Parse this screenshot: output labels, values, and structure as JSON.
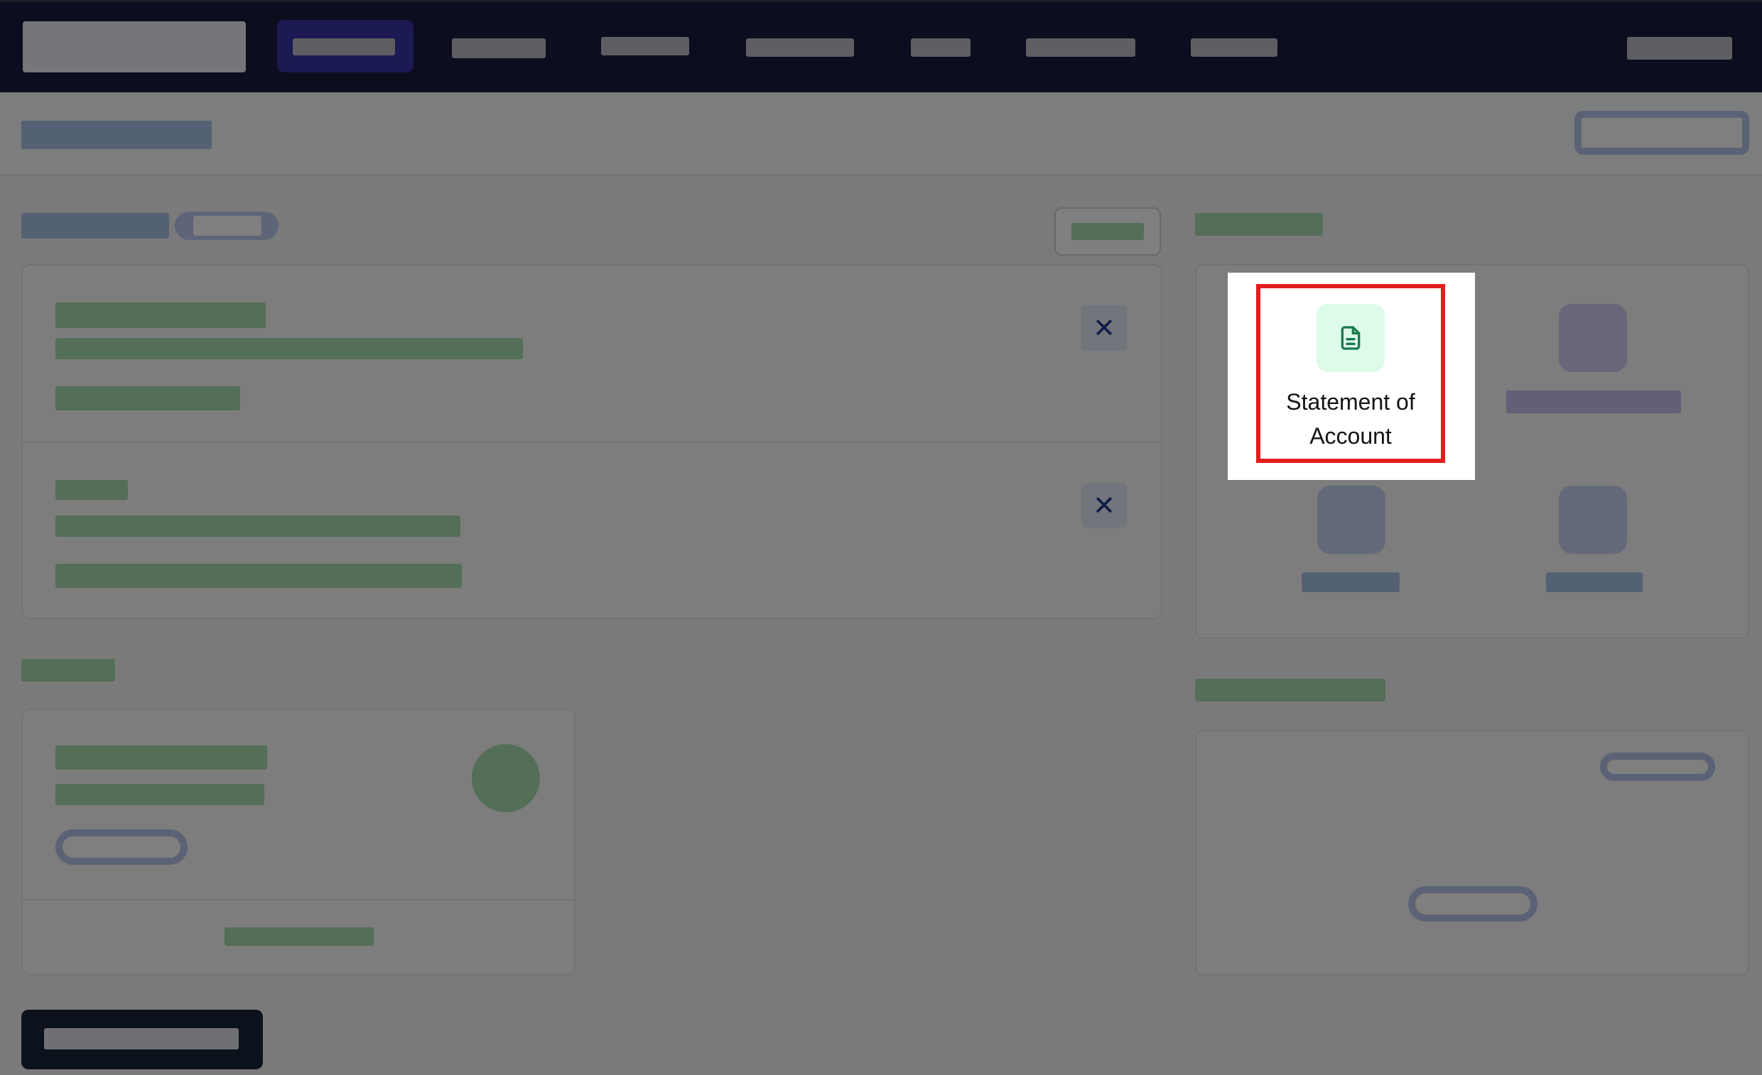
{
  "spotlight_tile": {
    "label": "Statement of Account",
    "icon": "document-icon",
    "icon_color": "#1a7a4c",
    "icon_bg": "#dcfbe9"
  },
  "highlight_color": "#e41e1e",
  "close_glyph": "✕"
}
